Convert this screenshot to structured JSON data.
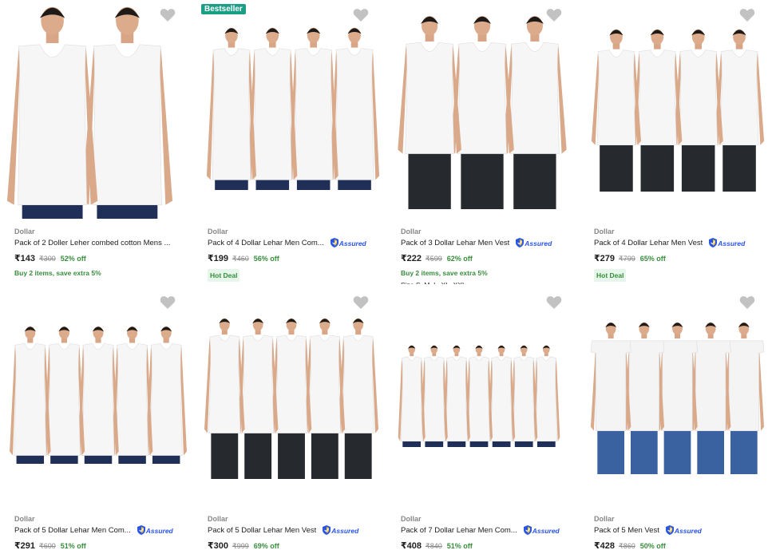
{
  "products": [
    {
      "brand": "Dollar",
      "title": "Pack of 2 Doller Leher combed cotton Mens ...",
      "assured": "",
      "price": "₹143",
      "mrp": "₹300",
      "off": "52% off",
      "offer": "Buy 2 items, save extra 5%",
      "badge": "",
      "hot": "",
      "sizes": "",
      "models": 2,
      "style": "vest"
    },
    {
      "brand": "Dollar",
      "title": "Pack of 4 Dollar Lehar Men Com...",
      "assured": "Assured",
      "price": "₹199",
      "mrp": "₹460",
      "off": "56% off",
      "offer": "",
      "badge": "Bestseller",
      "hot": "Hot Deal",
      "sizes": "",
      "models": 4,
      "style": "vest"
    },
    {
      "brand": "Dollar",
      "title": "Pack of 3 Dollar Lehar Men Vest",
      "assured": "Assured",
      "price": "₹222",
      "mrp": "₹599",
      "off": "62% off",
      "offer": "Buy 2 items, save extra 5%",
      "badge": "",
      "hot": "",
      "sizes": "Size S, M, L, XL, XXL",
      "models": 3,
      "style": "dark"
    },
    {
      "brand": "Dollar",
      "title": "Pack of 4 Dollar Lehar Men Vest",
      "assured": "Assured",
      "price": "₹279",
      "mrp": "₹799",
      "off": "65% off",
      "offer": "",
      "badge": "",
      "hot": "Hot Deal",
      "sizes": "",
      "models": 4,
      "style": "dark"
    },
    {
      "brand": "Dollar",
      "title": "Pack of 5 Dollar Lehar Men Com...",
      "assured": "Assured",
      "price": "₹291",
      "mrp": "₹600",
      "off": "51% off",
      "offer": "",
      "badge": "",
      "hot": "",
      "sizes": "",
      "models": 5,
      "style": "vest"
    },
    {
      "brand": "Dollar",
      "title": "Pack of 5 Dollar Lehar Men Vest",
      "assured": "Assured",
      "price": "₹300",
      "mrp": "₹999",
      "off": "69% off",
      "offer": "",
      "badge": "",
      "hot": "",
      "sizes": "",
      "models": 5,
      "style": "dark"
    },
    {
      "brand": "Dollar",
      "title": "Pack of 7 Dollar Lehar Men Com...",
      "assured": "Assured",
      "price": "₹408",
      "mrp": "₹840",
      "off": "51% off",
      "offer": "",
      "badge": "",
      "hot": "",
      "sizes": "",
      "models": 7,
      "style": "vest"
    },
    {
      "brand": "Dollar",
      "title": "Pack of 5 Men Vest",
      "assured": "Assured",
      "price": "₹428",
      "mrp": "₹860",
      "off": "50% off",
      "offer": "",
      "badge": "",
      "hot": "",
      "sizes": "",
      "models": 5,
      "style": "tshirt"
    }
  ],
  "colors": {
    "price_off": "#388e3c",
    "assured": "#2a55e5",
    "badge": "#1a9e86",
    "wishlist": "#c2c2c2"
  },
  "icons": {
    "wishlist": "heart-icon",
    "assured": "shield-icon"
  }
}
